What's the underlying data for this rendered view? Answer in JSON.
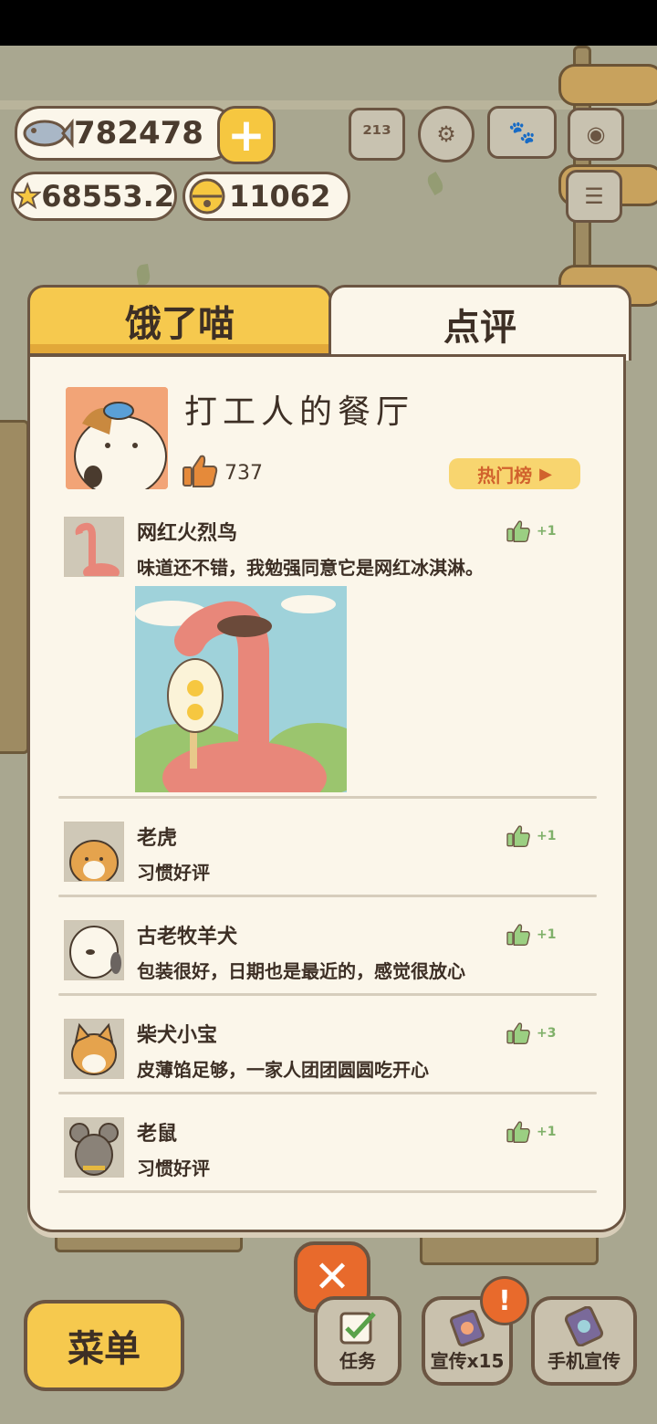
{
  "hud": {
    "fish": "782478",
    "stars": "68553.2",
    "bells": "11062"
  },
  "tabs": {
    "left": "饿了喵",
    "right": "点评"
  },
  "restaurant": {
    "name": "打工人的餐厅",
    "likes": "737",
    "hot_label": "热门榜"
  },
  "reviews": [
    {
      "name": "网红火烈鸟",
      "text": "味道还不错，我勉强同意它是网红冰淇淋。",
      "likes": "+1"
    },
    {
      "name": "老虎",
      "text": "习惯好评",
      "likes": "+1"
    },
    {
      "name": "古老牧羊犬",
      "text": "包装很好，日期也是最近的，感觉很放心",
      "likes": "+1"
    },
    {
      "name": "柴犬小宝",
      "text": "皮薄馅足够，一家人团团圆圆吃开心",
      "likes": "+3"
    },
    {
      "name": "老鼠",
      "text": "习惯好评",
      "likes": "+1"
    }
  ],
  "bottom": {
    "menu": "菜单",
    "tasks": "任务",
    "promo": "宣传x15",
    "phone_promo": "手机宣传",
    "badge": "!"
  },
  "colors": {
    "accent": "#f6c94e",
    "panel": "#fbf6ea",
    "outline": "#6b5542",
    "like_green": "#7fb069"
  }
}
